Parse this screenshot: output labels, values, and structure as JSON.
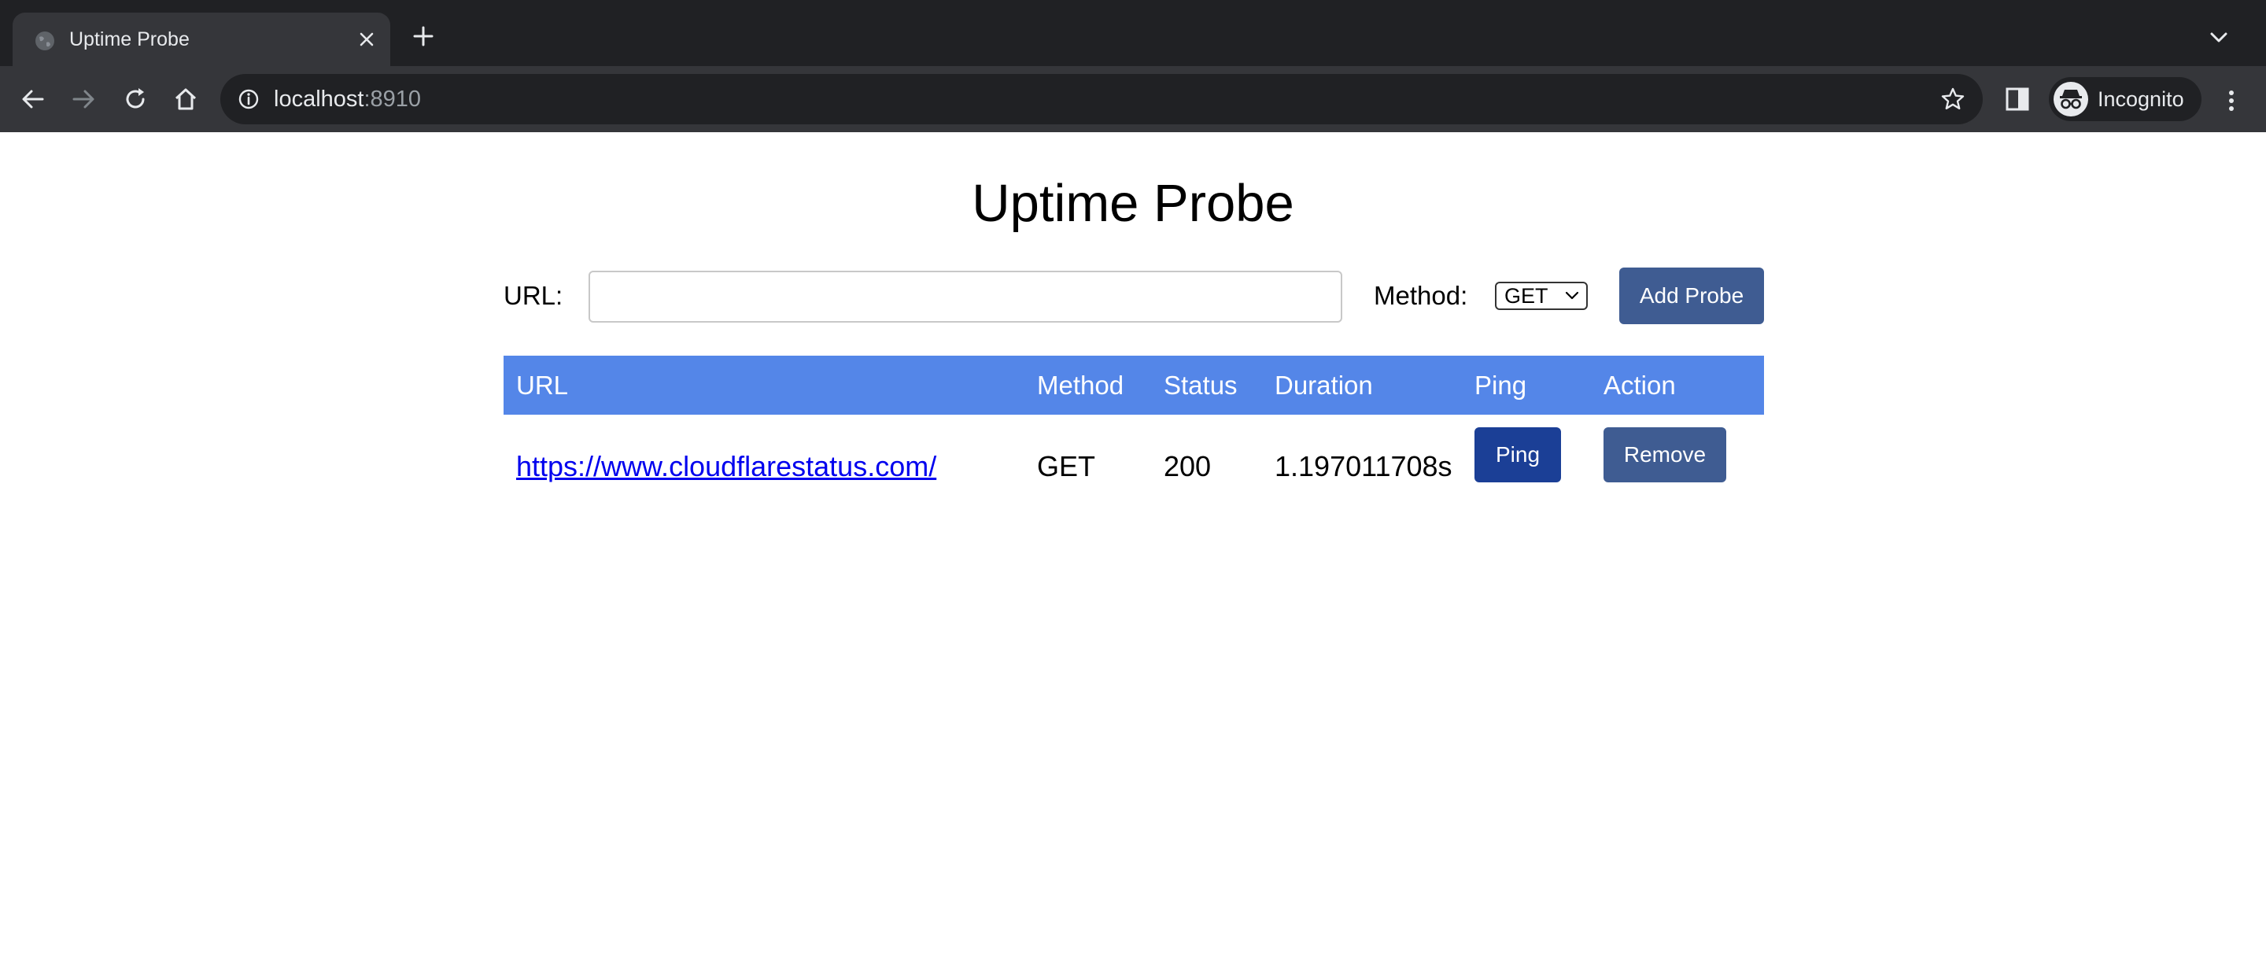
{
  "browser": {
    "tab": {
      "title": "Uptime Probe"
    },
    "address_bar": {
      "host": "localhost",
      "port": ":8910"
    },
    "profile": {
      "label": "Incognito"
    },
    "colors": {
      "chrome_dark": "#202124",
      "chrome_toolbar": "#35363a"
    }
  },
  "page": {
    "title": "Uptime Probe",
    "form": {
      "url_label": "URL:",
      "url_value": "",
      "url_placeholder": "",
      "method_label": "Method:",
      "method_selected": "GET",
      "add_button": "Add Probe"
    },
    "table": {
      "headers": [
        "URL",
        "Method",
        "Status",
        "Duration",
        "Ping",
        "Action"
      ],
      "rows": [
        {
          "url": "https://www.cloudflarestatus.com/",
          "method": "GET",
          "status": "200",
          "duration": "1.197011708s",
          "ping_button": "Ping",
          "remove_button": "Remove"
        }
      ]
    },
    "colors": {
      "header_bg": "#5486e8",
      "primary_button": "#3f5c92",
      "ping_button": "#1b3f96",
      "link": "#0000ee"
    }
  }
}
